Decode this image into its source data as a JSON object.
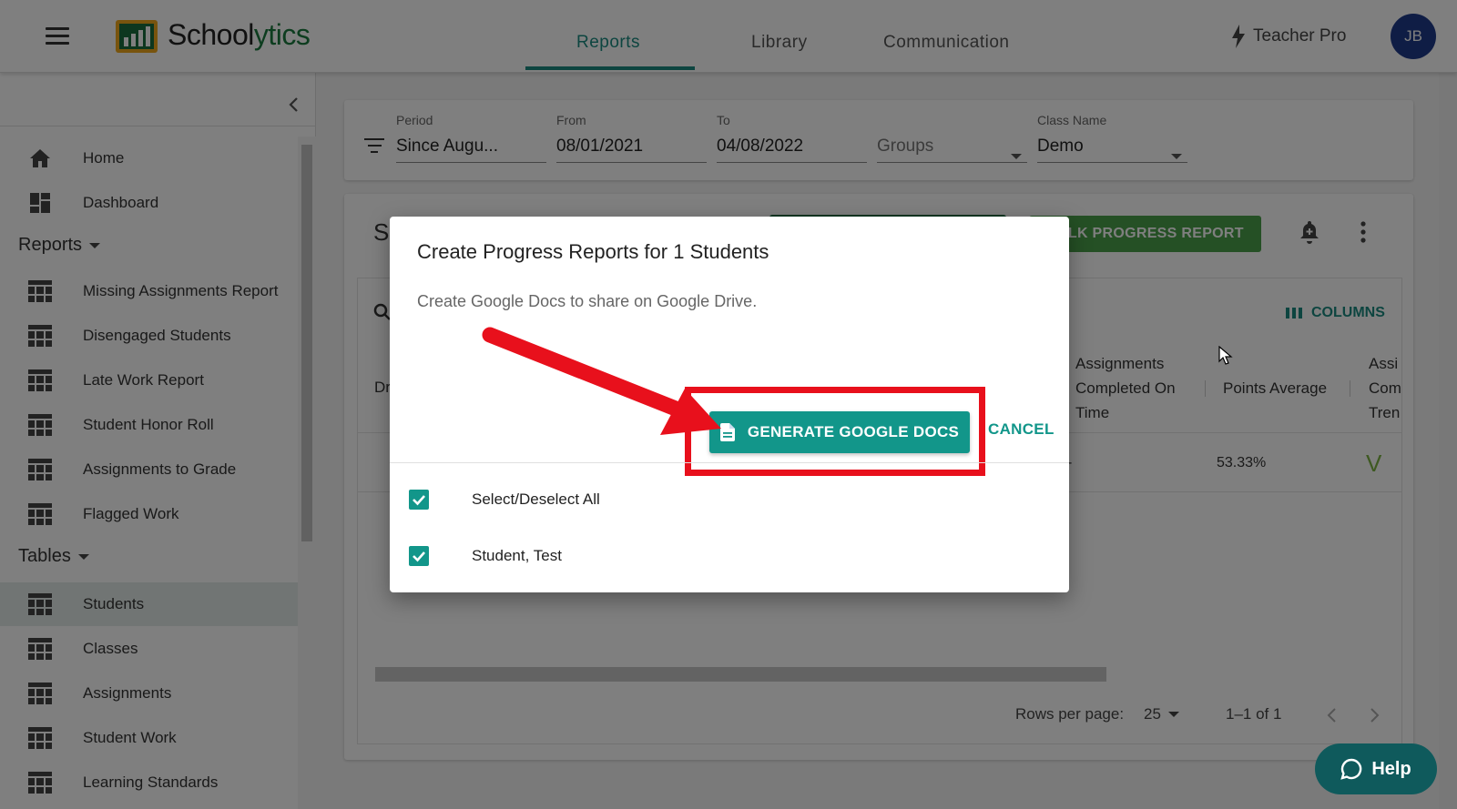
{
  "app": {
    "name_part1": "School",
    "name_part2": "ytics",
    "plan": "Teacher Pro",
    "avatar_initials": "JB",
    "accent": "#1b8a80"
  },
  "nav_tabs": [
    "Reports",
    "Library",
    "Communication"
  ],
  "sidebar": {
    "top_items": [
      "Home",
      "Dashboard"
    ],
    "reports_heading": "Reports",
    "reports_items": [
      "Missing Assignments Report",
      "Disengaged Students",
      "Late Work Report",
      "Student Honor Roll",
      "Assignments to Grade",
      "Flagged Work"
    ],
    "tables_heading": "Tables",
    "tables_items": [
      "Students",
      "Classes",
      "Assignments",
      "Student Work",
      "Learning Standards"
    ],
    "active_item": "Students"
  },
  "filters": {
    "period": {
      "label": "Period",
      "value": "Since Augu..."
    },
    "from": {
      "label": "From",
      "value": "08/01/2021"
    },
    "to": {
      "label": "To",
      "value": "04/08/2022"
    },
    "groups": {
      "placeholder": "Groups"
    },
    "class_name": {
      "label": "Class Name",
      "value": "Demo"
    }
  },
  "toolbar": {
    "bulk_label": "BULK PROGRESS REPORT",
    "columns_label": "COLUMNS"
  },
  "table": {
    "headers": [
      "Assignments Completed On Time",
      "Points Average",
      "Assi Com Tren"
    ],
    "row": {
      "completed": "-",
      "points_average": "53.33%",
      "trend": "V"
    },
    "partial_title": "S",
    "partial_col": "Dr"
  },
  "pagination": {
    "rows_label": "Rows per page:",
    "rows_value": "25",
    "range": "1–1 of 1"
  },
  "dialog": {
    "title": "Create Progress Reports for 1 Students",
    "subtitle": "Create Google Docs to share on Google Drive.",
    "primary_label": "GENERATE GOOGLE DOCS",
    "cancel_label": "CANCEL",
    "items": [
      {
        "label": "Select/Deselect All",
        "checked": true
      },
      {
        "label": "Student, Test",
        "checked": true
      }
    ]
  },
  "help": {
    "label": "Help"
  }
}
